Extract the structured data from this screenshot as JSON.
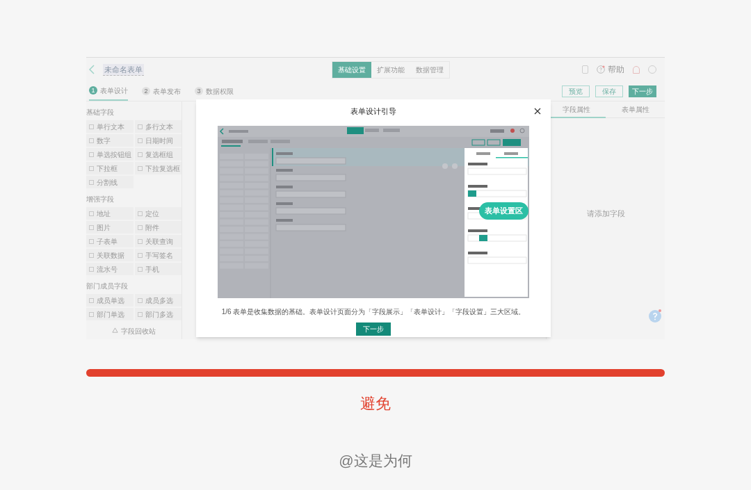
{
  "header": {
    "title": "未命名表单",
    "tabs": [
      {
        "label": "基础设置",
        "selected": true
      },
      {
        "label": "扩展功能",
        "selected": false
      },
      {
        "label": "数据管理",
        "selected": false
      }
    ],
    "help": "帮助"
  },
  "steps": [
    {
      "number": "1",
      "label": "表单设计",
      "selected": true
    },
    {
      "number": "2",
      "label": "表单发布",
      "selected": false
    },
    {
      "number": "3",
      "label": "数据权限",
      "selected": false
    }
  ],
  "actions": [
    {
      "label": "预览",
      "kind": "outline"
    },
    {
      "label": "保存",
      "kind": "outline"
    },
    {
      "label": "下一步",
      "kind": "primary"
    }
  ],
  "field_groups": [
    {
      "title": "基础字段",
      "items": [
        "单行文本",
        "多行文本",
        "数字",
        "日期时间",
        "单选按钮组",
        "复选框组",
        "下拉框",
        "下拉复选框",
        "分割线"
      ]
    },
    {
      "title": "增强字段",
      "items": [
        "地址",
        "定位",
        "图片",
        "附件",
        "子表单",
        "关联查询",
        "关联数据",
        "手写签名",
        "流水号",
        "手机"
      ]
    },
    {
      "title": "部门成员字段",
      "items": [
        "成员单选",
        "成员多选",
        "部门单选",
        "部门多选"
      ]
    }
  ],
  "recycle": "字段回收站",
  "properties": {
    "tabs": [
      {
        "label": "字段属性",
        "selected": true
      },
      {
        "label": "表单属性",
        "selected": false
      }
    ],
    "empty": "请添加字段"
  },
  "dialog": {
    "title": "表单设计引导",
    "callout": "表单设置区",
    "caption": "1/6 表单是收集数据的基础。表单设计页面分为「字段展示」「表单设计」「字段设置」三大区域。",
    "button": "下一步"
  },
  "verdict": "避免",
  "credit": "@这是为何"
}
